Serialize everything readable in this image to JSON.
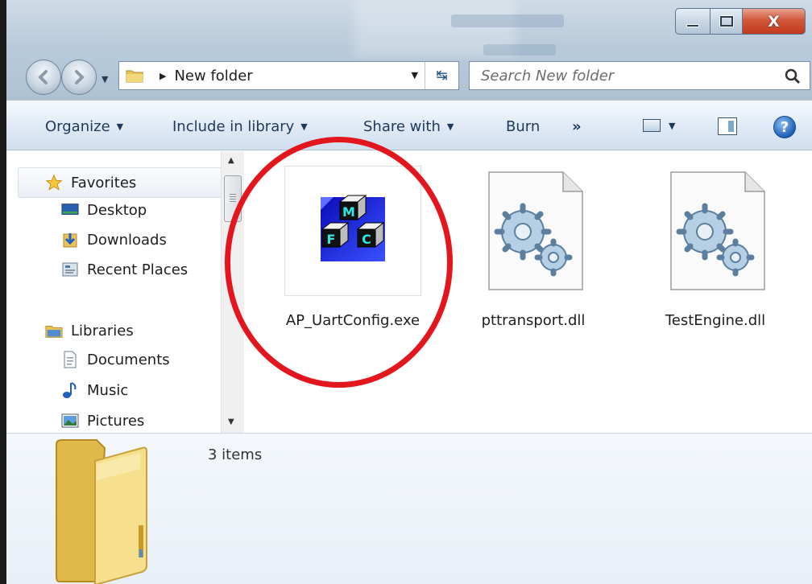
{
  "window": {
    "caption": {
      "minimize_icon": "minimize-icon",
      "maximize_icon": "maximize-icon",
      "close_label": "X"
    }
  },
  "address_bar": {
    "breadcrumb": [
      "New folder"
    ],
    "current": "New folder"
  },
  "search": {
    "placeholder": "Search New folder"
  },
  "toolbar": {
    "organize": "Organize",
    "include_in_library": "Include in library",
    "share_with": "Share with",
    "burn": "Burn",
    "more": "»",
    "help": "?"
  },
  "navigation": {
    "favorites": {
      "label": "Favorites",
      "items": [
        {
          "label": "Desktop",
          "icon": "desktop-icon"
        },
        {
          "label": "Downloads",
          "icon": "downloads-icon"
        },
        {
          "label": "Recent Places",
          "icon": "recent-places-icon"
        }
      ]
    },
    "libraries": {
      "label": "Libraries",
      "items": [
        {
          "label": "Documents",
          "icon": "documents-icon"
        },
        {
          "label": "Music",
          "icon": "music-icon"
        },
        {
          "label": "Pictures",
          "icon": "pictures-icon"
        }
      ]
    }
  },
  "files": [
    {
      "name": "AP_UartConfig.exe",
      "icon": "mfc-app-icon",
      "highlighted": true
    },
    {
      "name": "pttransport.dll",
      "icon": "dll-gears-icon"
    },
    {
      "name": "TestEngine.dll",
      "icon": "dll-gears-icon"
    }
  ],
  "details": {
    "item_count": "3 items"
  },
  "colors": {
    "annotation_circle": "#e2161c",
    "toolbar_text": "#1e395b"
  }
}
